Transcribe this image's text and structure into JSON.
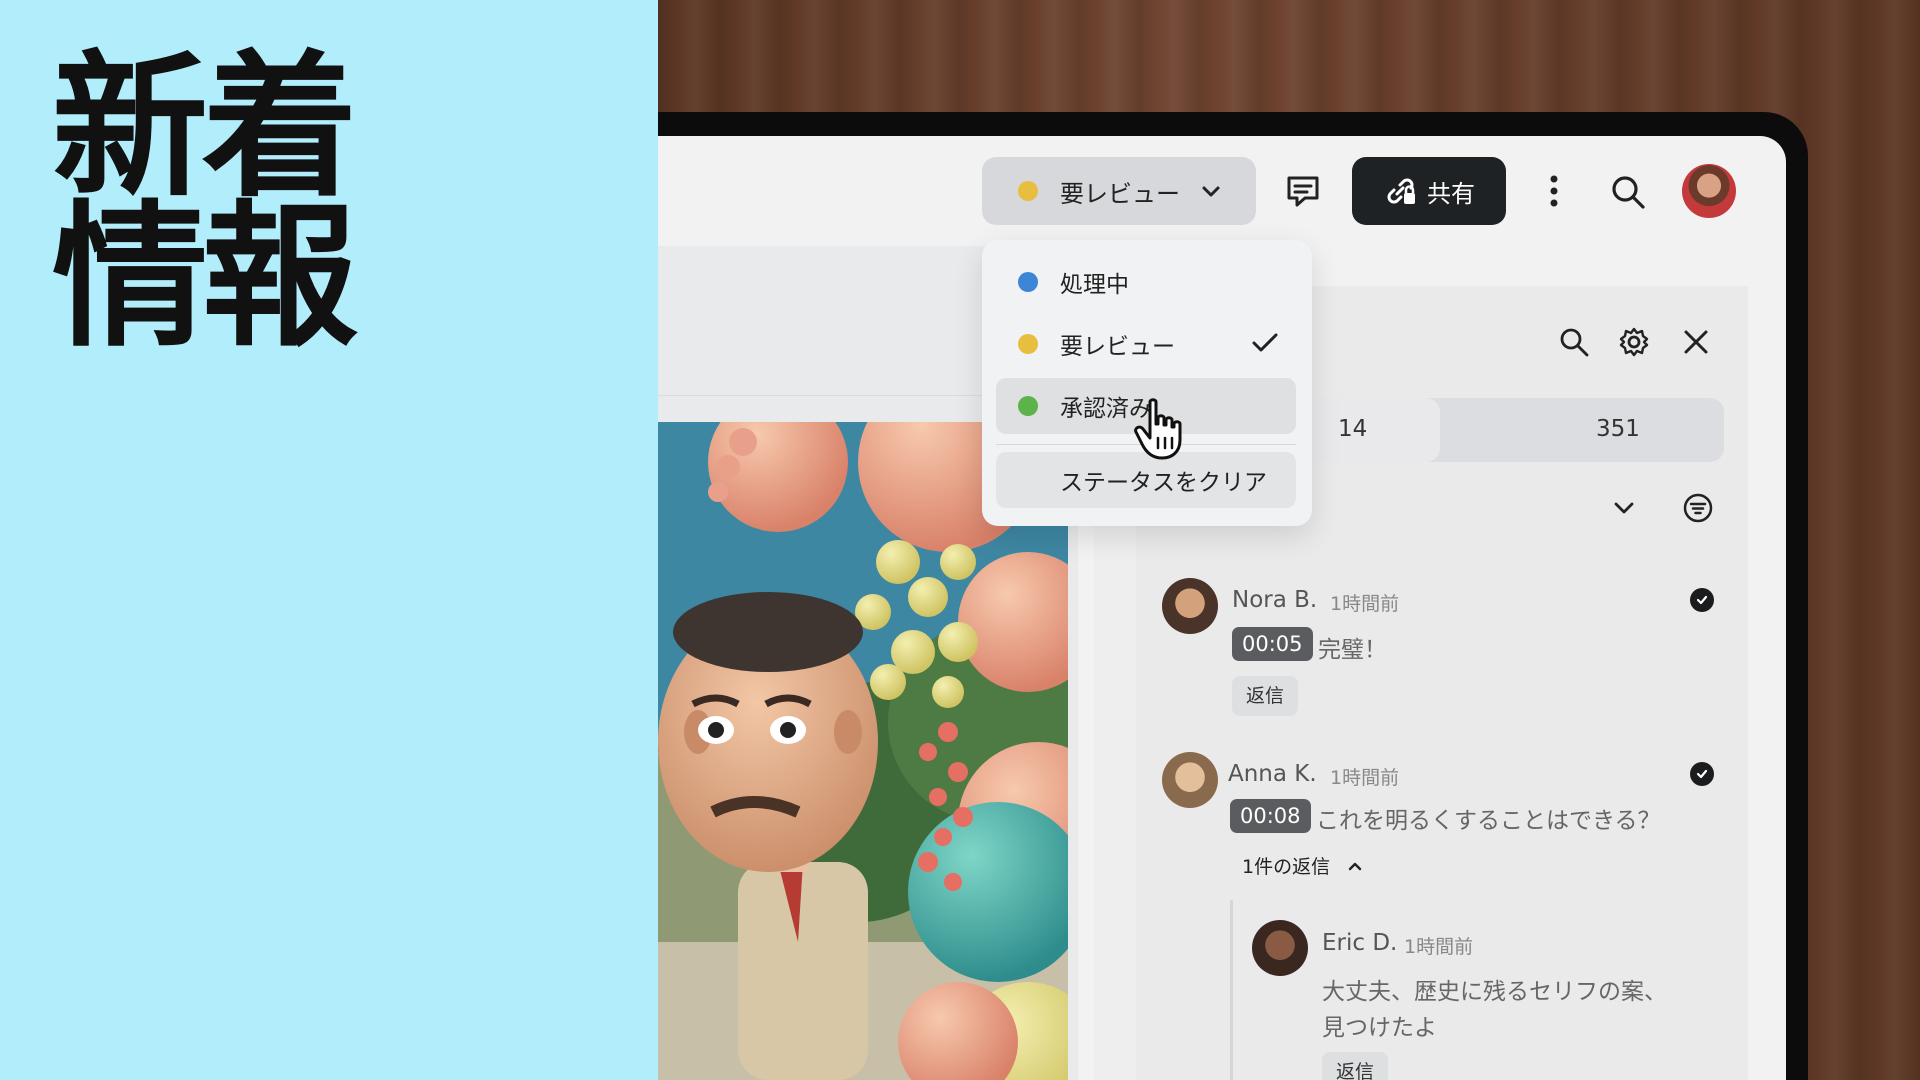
{
  "promo": {
    "title": "新着\n情報"
  },
  "toolbar": {
    "status": {
      "label": "要レビュー",
      "color": "#e7be3d"
    },
    "share_label": "共有"
  },
  "dropdown": {
    "items": [
      {
        "label": "処理中",
        "color": "#3d86d6",
        "selected": false
      },
      {
        "label": "要レビュー",
        "color": "#e7be3d",
        "selected": true
      },
      {
        "label": "承認済み",
        "color": "#5bb34a",
        "selected": false,
        "hovered": true
      }
    ],
    "clear_label": "ステータスをクリア"
  },
  "panel": {
    "tabs": [
      {
        "count": "14"
      },
      {
        "count": "351"
      }
    ]
  },
  "comments": [
    {
      "author": "Nora B.",
      "time": "1時間前",
      "timestamp": "00:05",
      "text": "完璧！",
      "reply_label": "返信",
      "resolved": true
    },
    {
      "author": "Anna K.",
      "time": "1時間前",
      "timestamp": "00:08",
      "text": "これを明るくすることはできる？",
      "replies_toggle": "1件の返信",
      "resolved": true,
      "replies": [
        {
          "author": "Eric D.",
          "time": "1時間前",
          "text_line1": "大丈夫、歴史に残るセリフの案、",
          "text_line2": "見つけたよ",
          "reply_label": "返信"
        }
      ]
    }
  ]
}
